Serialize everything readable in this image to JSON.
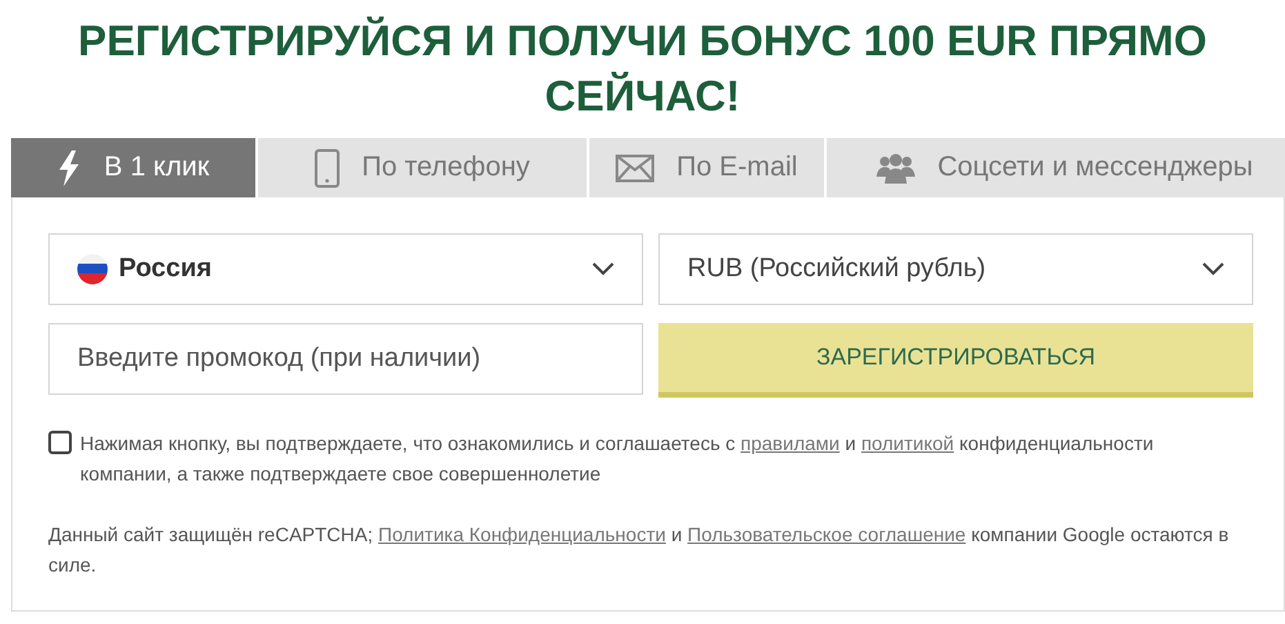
{
  "heading": "РЕГИСТРИРУЙСЯ И ПОЛУЧИ БОНУС 100 EUR ПРЯМО СЕЙЧАС!",
  "tabs": [
    {
      "kind": "bolt",
      "label": "В 1 клик",
      "selected": true
    },
    {
      "kind": "phone",
      "label": "По телефону",
      "selected": false
    },
    {
      "kind": "mail",
      "label": "По E-mail",
      "selected": false
    },
    {
      "kind": "people",
      "label": "Соцсети и мессенджеры",
      "selected": false
    }
  ],
  "country_select": {
    "value": "Россия"
  },
  "currency_select": {
    "value": "RUB (Российский рубль)"
  },
  "promo_field": {
    "placeholder": "Введите промокод (при наличии)"
  },
  "register_button": "ЗАРЕГИСТРИРОВАТЬСЯ",
  "agreement": {
    "checked": false,
    "parts": [
      {
        "kind": "text",
        "text": "Нажимая кнопку, вы подтверждаете, что ознакомились и соглашаетесь с "
      },
      {
        "kind": "link",
        "text": "правилами"
      },
      {
        "kind": "text",
        "text": " и "
      },
      {
        "kind": "link",
        "text": "политикой"
      },
      {
        "kind": "text",
        "text": " конфиденциальности компании, а также подтверждаете свое совершеннолетие"
      }
    ]
  },
  "recaptcha_note": {
    "parts": [
      {
        "kind": "text",
        "text": "Данный сайт защищён reCAPTCHA; "
      },
      {
        "kind": "link",
        "text": "Политика Конфиденциальности"
      },
      {
        "kind": "text",
        "text": " и "
      },
      {
        "kind": "link",
        "text": "Пользовательское соглашение"
      },
      {
        "kind": "text",
        "text": " компании Google остаются в силе."
      }
    ]
  }
}
